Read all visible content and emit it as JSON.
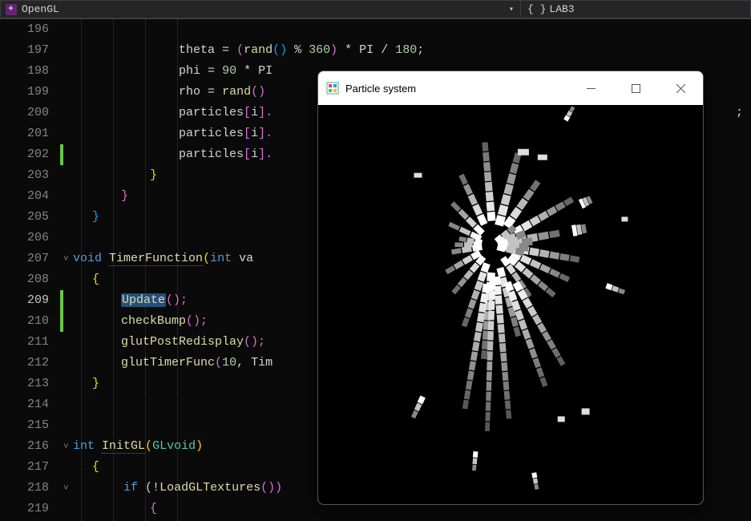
{
  "toolbar": {
    "scope": "OpenGL",
    "member": "LAB3",
    "brace_glyph": "{ }"
  },
  "gutter": {
    "start": 196,
    "end": 219
  },
  "current_line": 209,
  "change_markers": [
    {
      "line": 202
    },
    {
      "line": 209
    },
    {
      "line": 210
    }
  ],
  "code": {
    "l196": "",
    "l197": {
      "theta": "theta",
      "eq": " = ",
      "p1": "(",
      "rand": "rand",
      "p2": "()",
      "mod": " % ",
      "n360": "360",
      "p3": ")",
      "mul": " * ",
      "PI": "PI",
      "div": " / ",
      "n180": "180",
      "semi": ";"
    },
    "l198": {
      "phi": "phi",
      "eq": " = ",
      "n90": "90",
      "mul": " * ",
      "PI": "PI"
    },
    "l199": {
      "rho": "rho",
      "eq": " = ",
      "rand": "rand",
      "p": "()"
    },
    "l200": {
      "particles": "particles",
      "b1": "[",
      "i": "i",
      "b2": "].",
      "semi": ";"
    },
    "l201": {
      "particles": "particles",
      "b1": "[",
      "i": "i",
      "b2": "]."
    },
    "l202": {
      "particles": "particles",
      "b1": "[",
      "i": "i",
      "b2": "]."
    },
    "l203": {
      "brace": "}"
    },
    "l204": {
      "brace": "}"
    },
    "l205": {
      "brace": "}"
    },
    "l207": {
      "void": "void",
      "fn": "TimerFunction",
      "p1": "(",
      "int": "int",
      "va": " va"
    },
    "l208": {
      "brace": "{"
    },
    "l209": {
      "fn": "Update",
      "p": "();"
    },
    "l210": {
      "fn": "checkBump",
      "p": "();"
    },
    "l211": {
      "fn": "glutPostRedisplay",
      "p": "();"
    },
    "l212": {
      "fn": "glutTimerFunc",
      "p1": "(",
      "n10": "10",
      "c": ", ",
      "ti": "Tim"
    },
    "l213": {
      "brace": "}"
    },
    "l216": {
      "int": "int",
      "fn": "InitGL",
      "p1": "(",
      "type": "GLvoid",
      "p2": ")"
    },
    "l217": {
      "brace": "{"
    },
    "l218": {
      "if": "if",
      "p1": " (",
      "neg": "!",
      "fn": "LoadGLTextures",
      "p2": "())"
    },
    "l219": {
      "brace": "{"
    }
  },
  "particle_window": {
    "title": "Particle system",
    "min": "—",
    "max": "□",
    "close": "✕"
  }
}
